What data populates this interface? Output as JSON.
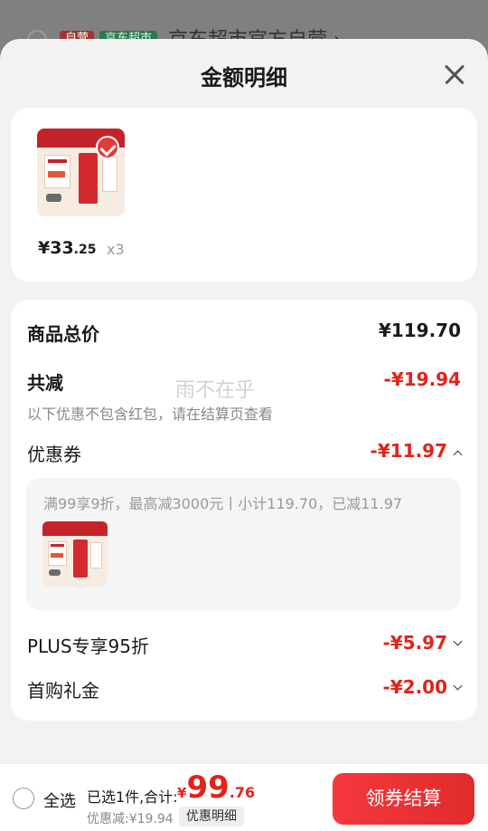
{
  "background": {
    "tag_self": "自营",
    "tag_market": "京东超市",
    "shop_name": "京东超市官方自营 ›"
  },
  "sheet": {
    "title": "金额明细",
    "close_icon": "close-icon"
  },
  "product": {
    "image_alt": "milk product thumbnail",
    "price_main": "¥33",
    "price_cents": ".25",
    "quantity": "x3",
    "selected": true
  },
  "summary": {
    "total_label": "商品总价",
    "total_value": "¥119.70",
    "reduce_label": "共减",
    "reduce_value": "-¥19.94",
    "note": "以下优惠不包含红包，请在结算页查看",
    "watermark": "雨不在乎"
  },
  "discounts": [
    {
      "label": "优惠券",
      "value": "-¥11.97",
      "expanded": true
    },
    {
      "label": "PLUS专享95折",
      "value": "-¥5.97",
      "expanded": false
    },
    {
      "label": "首购礼金",
      "value": "-¥2.00",
      "expanded": false
    }
  ],
  "coupon_detail": {
    "description": "满99享9折，最高减3000元丨小计119.70，已减11.97"
  },
  "bottom": {
    "select_all": "全选",
    "selected_text": "已选1件,合计:",
    "currency": "¥",
    "total_int": "99",
    "total_dec": ".76",
    "discount_text": "优惠减:¥19.94",
    "detail_button": "优惠明细",
    "checkout_button": "领券结算"
  },
  "colors": {
    "accent_red": "#e2231a",
    "checkout_gradient_start": "#f5383e",
    "checkout_gradient_end": "#e02b2b"
  }
}
